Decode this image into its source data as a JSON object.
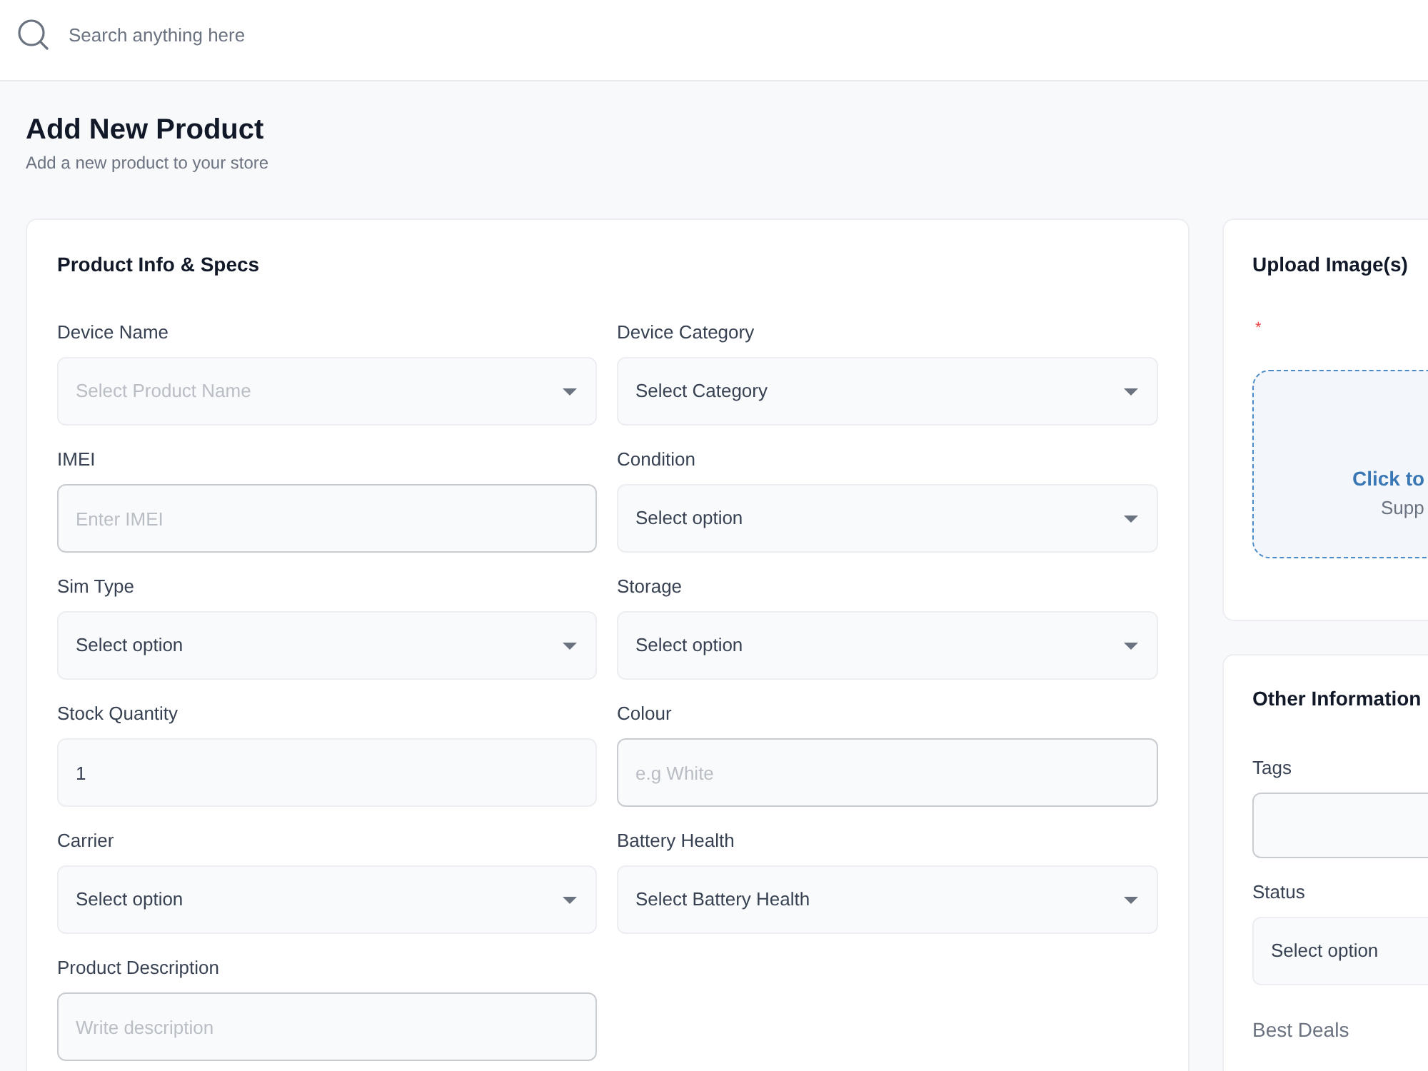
{
  "search": {
    "placeholder": "Search anything here"
  },
  "page": {
    "title": "Add New Product",
    "subtitle": "Add a new product to your store"
  },
  "product_info": {
    "title": "Product Info & Specs",
    "fields": [
      {
        "label": "Device Name",
        "kind": "select",
        "placeholder": "Select Product Name"
      },
      {
        "label": "Device Category",
        "kind": "select",
        "value": "Select Category"
      },
      {
        "label": "IMEI",
        "kind": "text",
        "placeholder": "Enter IMEI"
      },
      {
        "label": "Condition",
        "kind": "select",
        "value": "Select option"
      },
      {
        "label": "Sim Type",
        "kind": "select",
        "value": "Select option"
      },
      {
        "label": "Storage",
        "kind": "select",
        "value": "Select option"
      },
      {
        "label": "Stock Quantity",
        "kind": "number",
        "value": "1"
      },
      {
        "label": "Colour",
        "kind": "text",
        "placeholder": "e.g White"
      },
      {
        "label": "Carrier",
        "kind": "select",
        "value": "Select option"
      },
      {
        "label": "Battery Health",
        "kind": "select",
        "value": "Select Battery Health"
      },
      {
        "label": "Product Description",
        "kind": "text",
        "placeholder": "Write description"
      }
    ]
  },
  "upload": {
    "title": "Upload Image(s)",
    "required_mark": "*",
    "dropzone": {
      "prompt": "Click to",
      "hint": "Supp"
    }
  },
  "other_info": {
    "title": "Other Information",
    "fields": [
      {
        "label": "Tags",
        "kind": "text"
      },
      {
        "label": "Status",
        "kind": "select",
        "value": "Select option"
      }
    ],
    "best_deals_label": "Best Deals"
  }
}
